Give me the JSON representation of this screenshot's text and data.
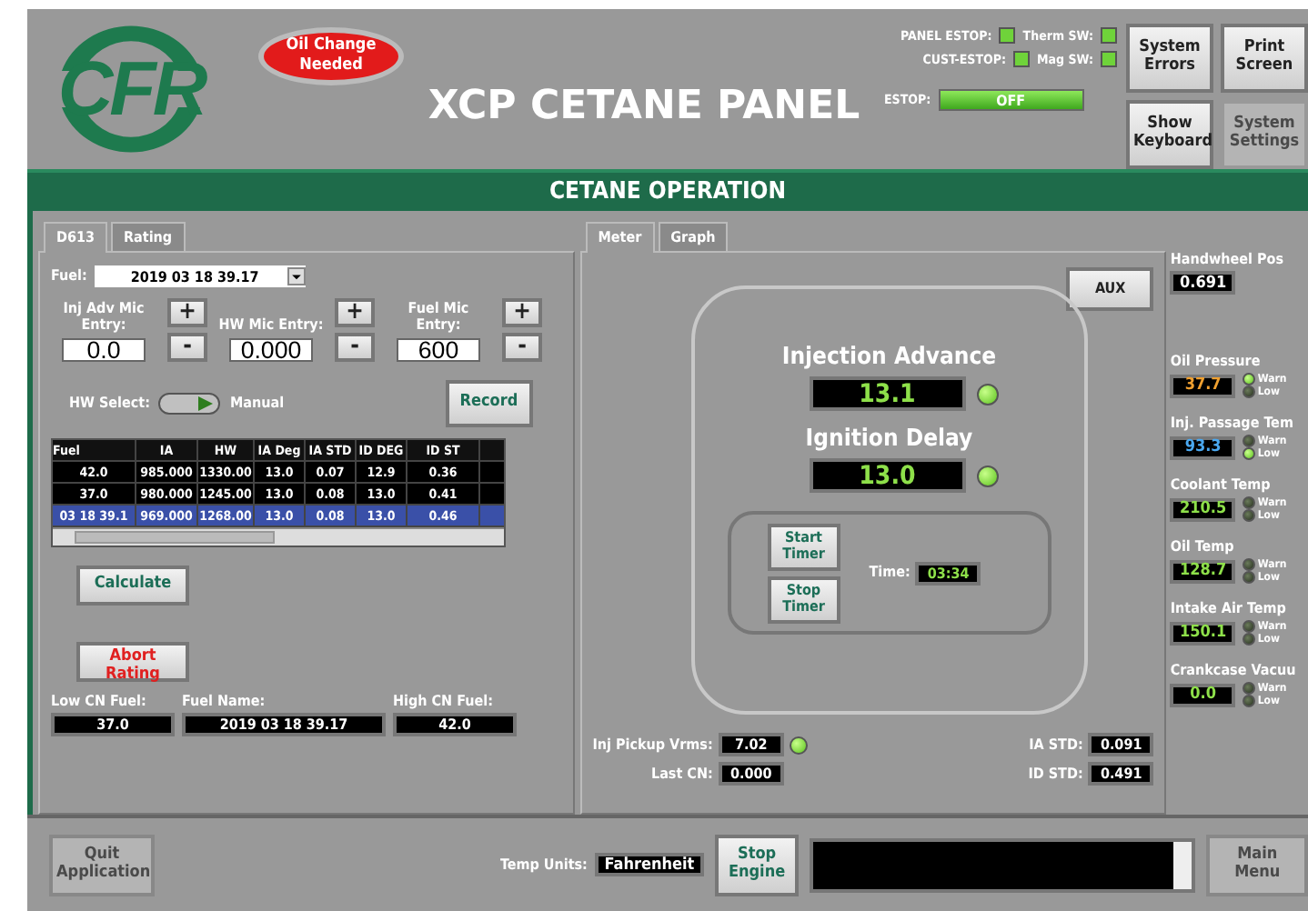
{
  "header": {
    "logo": "CFR",
    "alert": {
      "text": "Oil Change Needed",
      "on": true
    },
    "title": "XCP CETANE PANEL",
    "indicators": [
      {
        "label": "PANEL ESTOP:",
        "on": true
      },
      {
        "label": "Therm SW:",
        "on": true
      },
      {
        "label": "CUST-ESTOP:",
        "on": true
      },
      {
        "label": "Mag SW:",
        "on": true
      }
    ],
    "estop": {
      "label": "ESTOP:",
      "value": "OFF",
      "on": true
    },
    "buttons": [
      {
        "label": "System Errors",
        "disabled": false
      },
      {
        "label": "Print Screen",
        "disabled": false
      },
      {
        "label": "Show Keyboard",
        "disabled": false
      },
      {
        "label": "System Settings",
        "disabled": true
      }
    ]
  },
  "section_title": "CETANE OPERATION",
  "left_panel": {
    "tabs": [
      {
        "label": "D613",
        "selected": true
      },
      {
        "label": "Rating",
        "selected": false
      }
    ],
    "fuel": {
      "label": "Fuel:",
      "value": "2019 03 18 39.17"
    },
    "mic_entries": [
      {
        "label": "Inj Adv Mic Entry:",
        "value": "0.0",
        "plus": "+",
        "minus": "-"
      },
      {
        "label": "HW Mic Entry:",
        "value": "0.000",
        "plus": "+",
        "minus": "-"
      },
      {
        "label": "Fuel Mic Entry:",
        "value": "600",
        "plus": "+",
        "minus": "-"
      }
    ],
    "hw_select": {
      "label": "HW Select:",
      "value": "Manual",
      "on": true
    },
    "record": "Record",
    "table": {
      "columns": [
        "Fuel",
        "IA",
        "HW",
        "IA Deg",
        "IA STD",
        "ID DEG",
        "ID ST"
      ],
      "rows": [
        {
          "cells": [
            "42.0",
            "985.000",
            "1330.00",
            "13.0",
            "0.07",
            "12.9",
            "0.36"
          ],
          "selected": false
        },
        {
          "cells": [
            "37.0",
            "980.000",
            "1245.00",
            "13.0",
            "0.08",
            "13.0",
            "0.41"
          ],
          "selected": false
        },
        {
          "cells": [
            "03 18 39.1",
            "969.000",
            "1268.00",
            "13.0",
            "0.08",
            "13.0",
            "0.46"
          ],
          "selected": true
        }
      ]
    },
    "calculate": "Calculate",
    "abort": "Abort Rating",
    "readouts": [
      {
        "label": "Low CN Fuel:",
        "value": "37.0"
      },
      {
        "label": "Fuel Name:",
        "value": "2019 03 18 39.17"
      },
      {
        "label": "High CN Fuel:",
        "value": "42.0"
      }
    ]
  },
  "meter_panel": {
    "tabs": [
      {
        "label": "Meter",
        "selected": true
      },
      {
        "label": "Graph",
        "selected": false
      }
    ],
    "aux": "AUX",
    "gauges": [
      {
        "label": "Injection Advance",
        "value": "13.1",
        "on": true
      },
      {
        "label": "Ignition Delay",
        "value": "13.0",
        "on": true
      }
    ],
    "timer": {
      "start": "Start Timer",
      "stop": "Stop Timer",
      "label": "Time:",
      "value": "03:34"
    },
    "left_readouts": [
      {
        "label": "Inj Pickup Vrms:",
        "value": "7.02",
        "led": true
      },
      {
        "label": "Last CN:",
        "value": "0.000"
      }
    ],
    "right_readouts": [
      {
        "label": "IA STD:",
        "value": "0.091"
      },
      {
        "label": "ID STD:",
        "value": "0.491"
      }
    ]
  },
  "sensors": [
    {
      "name": "Handwheel Pos",
      "value": "0.691",
      "kind": "position"
    },
    {
      "name": "Oil Pressure",
      "value": "37.7",
      "kind": "pressure",
      "warn": {
        "label": "Warn",
        "on": true
      },
      "low": {
        "label": "Low",
        "on": false
      }
    },
    {
      "name": "Inj. Passage Tem",
      "value": "93.3",
      "kind": "passage",
      "warn": {
        "label": "Warn",
        "on": false
      },
      "low": {
        "label": "Low",
        "on": true
      }
    },
    {
      "name": "Coolant Temp",
      "value": "210.5",
      "kind": "temperature",
      "warn": {
        "label": "Warn",
        "on": false
      },
      "low": {
        "label": "Low",
        "on": false
      }
    },
    {
      "name": "Oil Temp",
      "value": "128.7",
      "kind": "temperature",
      "warn": {
        "label": "Warn",
        "on": false
      },
      "low": {
        "label": "Low",
        "on": false
      }
    },
    {
      "name": "Intake Air Temp",
      "value": "150.1",
      "kind": "temperature",
      "warn": {
        "label": "Warn",
        "on": false
      },
      "low": {
        "label": "Low",
        "on": false
      }
    },
    {
      "name": "Crankcase Vacuu",
      "value": "0.0",
      "kind": "vacuum",
      "warn": {
        "label": "Warn",
        "on": false
      },
      "low": {
        "label": "Low",
        "on": false
      }
    }
  ],
  "footer": {
    "quit": {
      "label": "Quit Application",
      "disabled": true
    },
    "temp_units": {
      "label": "Temp Units:",
      "value": "Fahrenheit"
    },
    "stop_engine": {
      "label": "Stop Engine",
      "disabled": false
    },
    "main_menu": {
      "label": "Main Menu",
      "disabled": true
    }
  }
}
